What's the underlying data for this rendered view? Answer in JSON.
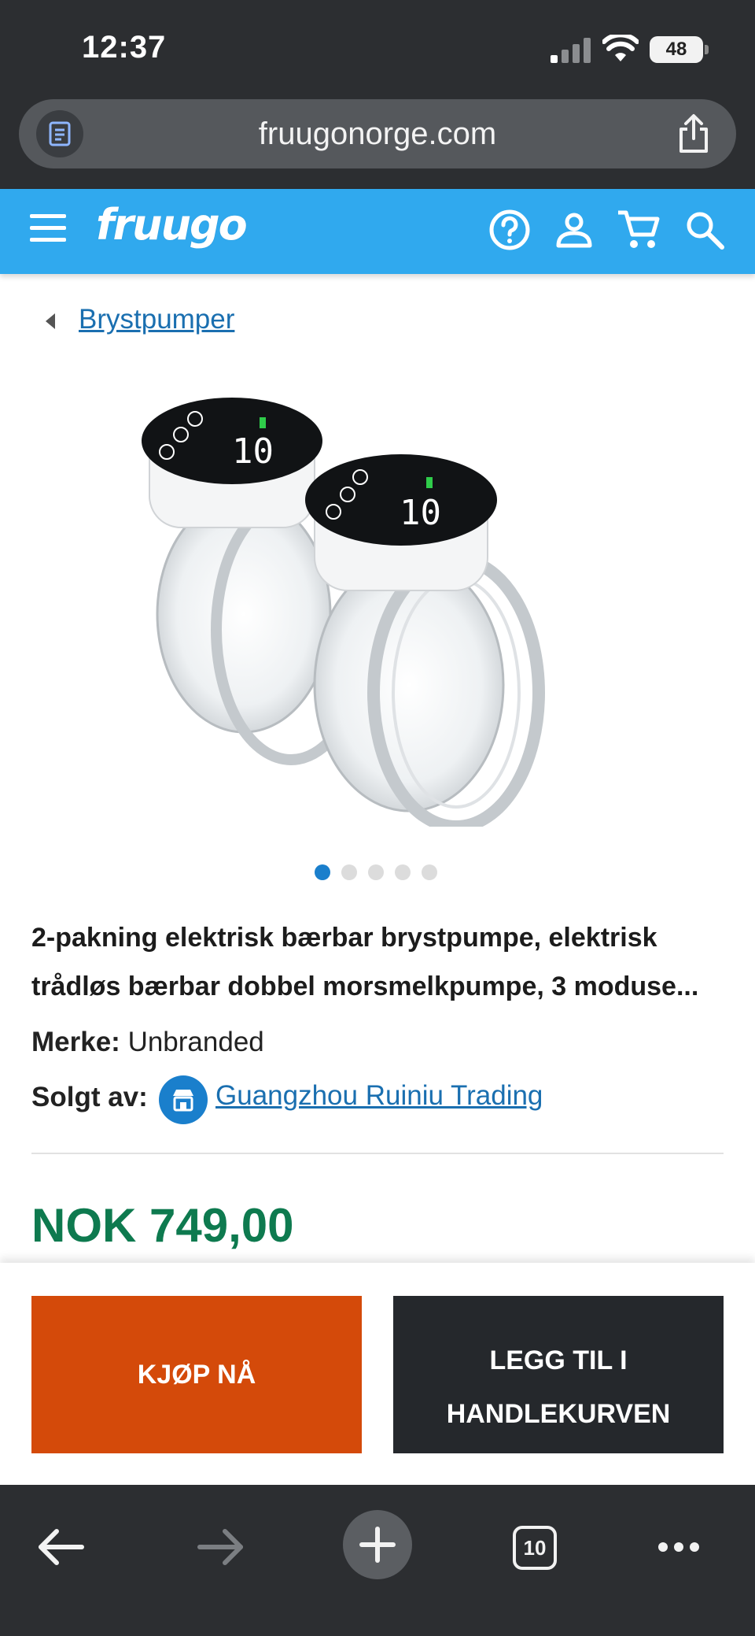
{
  "status_bar": {
    "time": "12:37",
    "battery": "48"
  },
  "browser": {
    "url": "fruugonorge.com",
    "tab_count": "10"
  },
  "site_header": {
    "logo": "fruugo",
    "accent_color": "#30a9ee"
  },
  "breadcrumb": {
    "label": "Brystpumper"
  },
  "carousel": {
    "total": 5,
    "active_index": 0
  },
  "product": {
    "title": "2-pakning elektrisk bærbar brystpumpe, elektrisk trådløs bærbar dobbel morsmelkpumpe, 3 moduse...",
    "brand_label": "Merke:",
    "brand_value": "Unbranded",
    "seller_label": "Solgt av:",
    "seller_name": "Guangzhou Ruiniu Trading",
    "price": "NOK 749,00",
    "price_color": "#0e7a4f"
  },
  "actions": {
    "buy_now": "KJØP NÅ",
    "add_to_cart_line1": "LEGG TIL I",
    "add_to_cart_line2": "HANDLEKURVEN",
    "buy_color": "#d44a0a",
    "cart_color": "#25282c"
  },
  "icons": {
    "reader": "reader-icon",
    "share": "share-icon",
    "menu": "menu-icon",
    "help": "help-icon",
    "account": "account-icon",
    "cart": "cart-icon",
    "search": "search-icon",
    "store": "store-icon",
    "back": "back-arrow-icon",
    "forward": "forward-arrow-icon",
    "new_tab": "plus-icon",
    "more": "more-icon"
  }
}
